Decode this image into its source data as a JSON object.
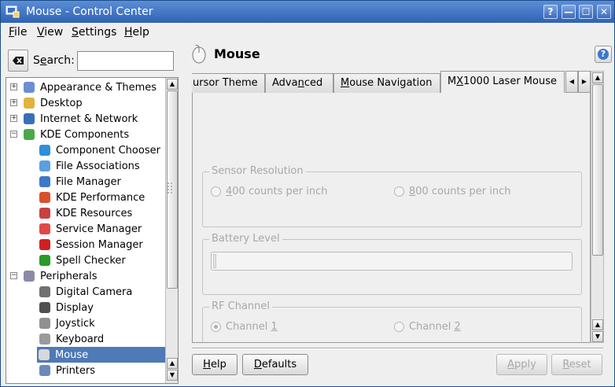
{
  "window": {
    "title": "Mouse - Control Center",
    "controls": {
      "help": "?",
      "minimize": "—",
      "maximize": "☐",
      "close": "✕"
    }
  },
  "menubar": [
    {
      "label": "File",
      "key": "F",
      "rest": "ile"
    },
    {
      "label": "View",
      "key": "V",
      "rest": "iew"
    },
    {
      "label": "Settings",
      "key": "S",
      "rest": "ettings"
    },
    {
      "label": "Help",
      "key": "H",
      "rest": "elp"
    }
  ],
  "search": {
    "label_pre": "S",
    "label_key": "e",
    "label_post": "arch:",
    "value": ""
  },
  "tree": [
    {
      "label": "Appearance & Themes",
      "icon": "appearance-icon",
      "level": 0,
      "expander": "+"
    },
    {
      "label": "Desktop",
      "icon": "desktop-icon",
      "level": 0,
      "expander": "+"
    },
    {
      "label": "Internet & Network",
      "icon": "network-icon",
      "level": 0,
      "expander": "+"
    },
    {
      "label": "KDE Components",
      "icon": "kde-components-icon",
      "level": 0,
      "expander": "−"
    },
    {
      "label": "Component Chooser",
      "icon": "component-chooser-icon",
      "level": 1
    },
    {
      "label": "File Associations",
      "icon": "file-associations-icon",
      "level": 1
    },
    {
      "label": "File Manager",
      "icon": "file-manager-icon",
      "level": 1
    },
    {
      "label": "KDE Performance",
      "icon": "kde-performance-icon",
      "level": 1
    },
    {
      "label": "KDE Resources",
      "icon": "kde-resources-icon",
      "level": 1
    },
    {
      "label": "Service Manager",
      "icon": "service-manager-icon",
      "level": 1
    },
    {
      "label": "Session Manager",
      "icon": "session-manager-icon",
      "level": 1
    },
    {
      "label": "Spell Checker",
      "icon": "spell-checker-icon",
      "level": 1
    },
    {
      "label": "Peripherals",
      "icon": "peripherals-icon",
      "level": 0,
      "expander": "−"
    },
    {
      "label": "Digital Camera",
      "icon": "camera-icon",
      "level": 1
    },
    {
      "label": "Display",
      "icon": "display-icon",
      "level": 1
    },
    {
      "label": "Joystick",
      "icon": "joystick-icon",
      "level": 1
    },
    {
      "label": "Keyboard",
      "icon": "keyboard-icon",
      "level": 1
    },
    {
      "label": "Mouse",
      "icon": "mouse-icon",
      "level": 1,
      "selected": true
    },
    {
      "label": "Printers",
      "icon": "printer-icon",
      "level": 1
    }
  ],
  "panel": {
    "title": "Mouse",
    "tabs": [
      {
        "label": "ursor Theme"
      },
      {
        "label": "Advanced",
        "pre": "Adva",
        "key": "n",
        "post": "ced"
      },
      {
        "label": "Mouse Navigation",
        "pre": "",
        "key": "M",
        "post": "ouse Navigation"
      },
      {
        "label": "MX1000 Laser Mouse",
        "pre": "M",
        "key": "X",
        "post": "1000 Laser Mouse",
        "active": true
      }
    ],
    "sensor": {
      "title": "Sensor Resolution",
      "opt1": {
        "key": "4",
        "rest": "00 counts per inch"
      },
      "opt2": {
        "key": "8",
        "rest": "00 counts per inch"
      }
    },
    "battery": {
      "title": "Battery Level",
      "level": 0
    },
    "rf": {
      "title": "RF Channel",
      "opt1": {
        "pre": "Channel ",
        "key": "1"
      },
      "opt2": {
        "pre": "Channel ",
        "key": "2"
      }
    }
  },
  "buttons": {
    "help": {
      "key": "H",
      "rest": "elp"
    },
    "defaults": {
      "key": "D",
      "rest": "efaults"
    },
    "apply": {
      "key": "A",
      "rest": "pply"
    },
    "reset": {
      "key": "R",
      "rest": "eset"
    }
  }
}
